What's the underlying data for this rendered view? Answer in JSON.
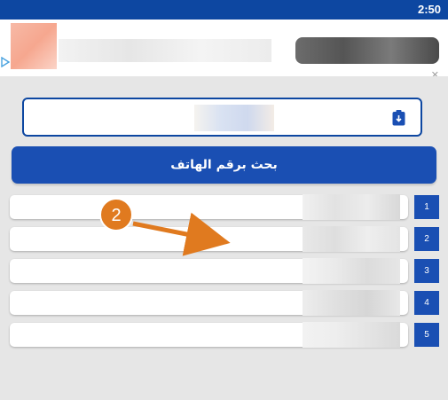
{
  "status_bar": {
    "time": "2:50"
  },
  "search": {
    "button_label": "بحث برقم الهاتف"
  },
  "results": [
    {
      "number": "1"
    },
    {
      "number": "2"
    },
    {
      "number": "3"
    },
    {
      "number": "4"
    },
    {
      "number": "5"
    }
  ],
  "annotation": {
    "step": "2"
  },
  "colors": {
    "primary": "#1a4fb3",
    "status_bar": "#0d47a1",
    "background": "#e6e6e6",
    "annotation": "#e07a1f"
  },
  "icons": [
    "contact-icon",
    "ad-choices-icon",
    "arrow-icon"
  ]
}
